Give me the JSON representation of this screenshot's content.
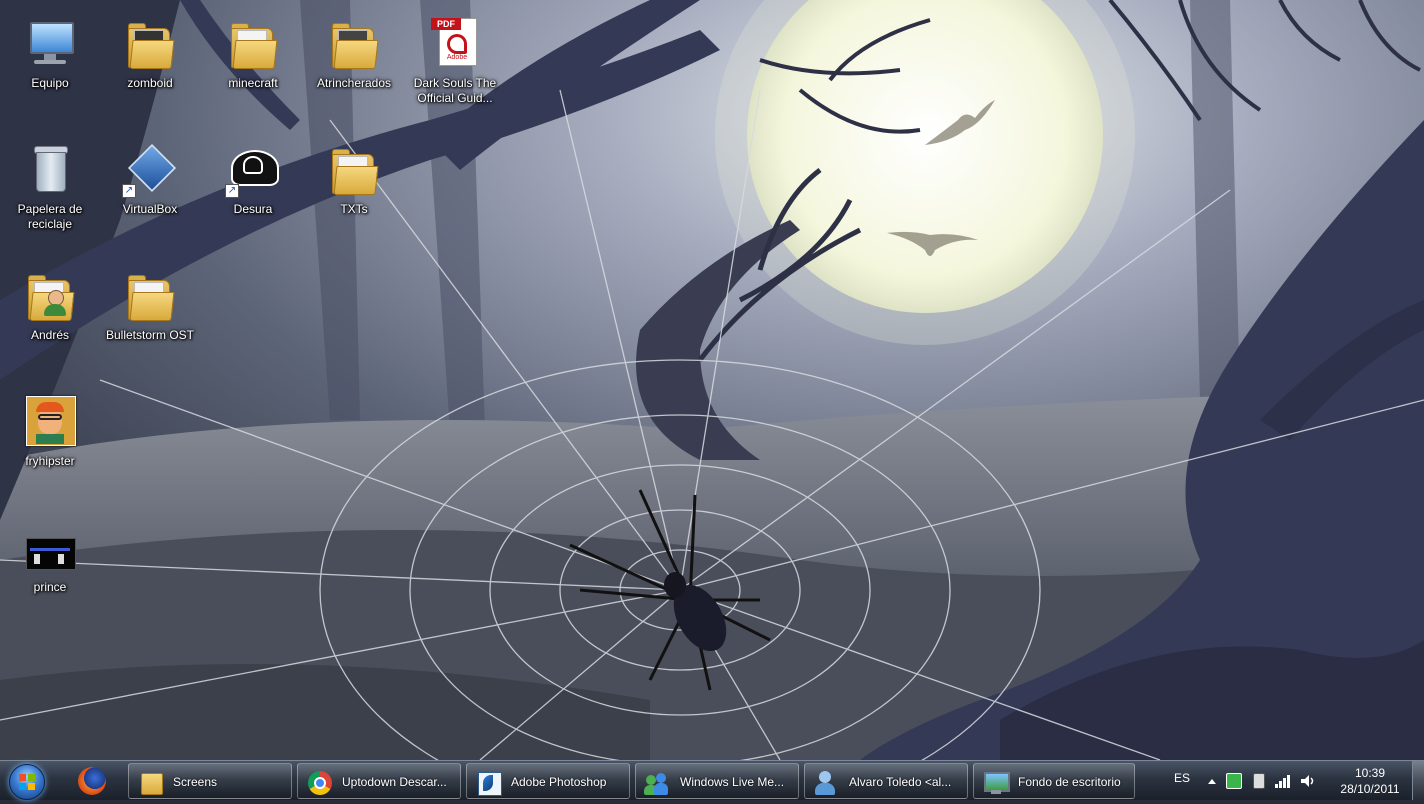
{
  "desktop": {
    "icons": [
      {
        "label": "Equipo",
        "icon": "computer-icon"
      },
      {
        "label": "zomboid",
        "icon": "folder-icon"
      },
      {
        "label": "minecraft",
        "icon": "folder-icon"
      },
      {
        "label": "Atrincherados",
        "icon": "folder-icon"
      },
      {
        "label": "Dark Souls The Official Guid...",
        "icon": "pdf-icon"
      },
      {
        "label": "Papelera de reciclaje",
        "icon": "recycle-bin-icon"
      },
      {
        "label": "VirtualBox",
        "icon": "virtualbox-icon"
      },
      {
        "label": "Desura",
        "icon": "desura-icon"
      },
      {
        "label": "TXTs",
        "icon": "folder-icon"
      },
      {
        "label": "Andrés",
        "icon": "user-folder-icon"
      },
      {
        "label": "Bulletstorm OST",
        "icon": "folder-icon"
      },
      {
        "label": "fryhipster",
        "icon": "image-icon"
      },
      {
        "label": "prince",
        "icon": "game-icon"
      }
    ],
    "pdf_badge": "PDF",
    "pdf_brand": "Adobe"
  },
  "taskbar": {
    "start_icon": "windows-start-orb-icon",
    "pinned": [
      {
        "icon": "firefox-icon"
      }
    ],
    "tasks": [
      {
        "label": "Screens",
        "icon": "folder-icon"
      },
      {
        "label": "Uptodown Descar...",
        "icon": "chrome-icon"
      },
      {
        "label": "Adobe Photoshop",
        "icon": "photoshop-icon"
      },
      {
        "label": "Windows Live Me...",
        "icon": "messenger-icon"
      },
      {
        "label": "Alvaro Toledo <al...",
        "icon": "messenger-contact-icon"
      },
      {
        "label": "Fondo de escritorio",
        "icon": "desktop-background-icon"
      }
    ],
    "tray": {
      "language": "ES",
      "time": "10:39",
      "date": "28/10/2011"
    }
  },
  "colors": {
    "moon": "#f4f6dc",
    "sky": "#6f7a8f",
    "tree": "#3a3f5e",
    "taskbar": "#2b3340"
  }
}
